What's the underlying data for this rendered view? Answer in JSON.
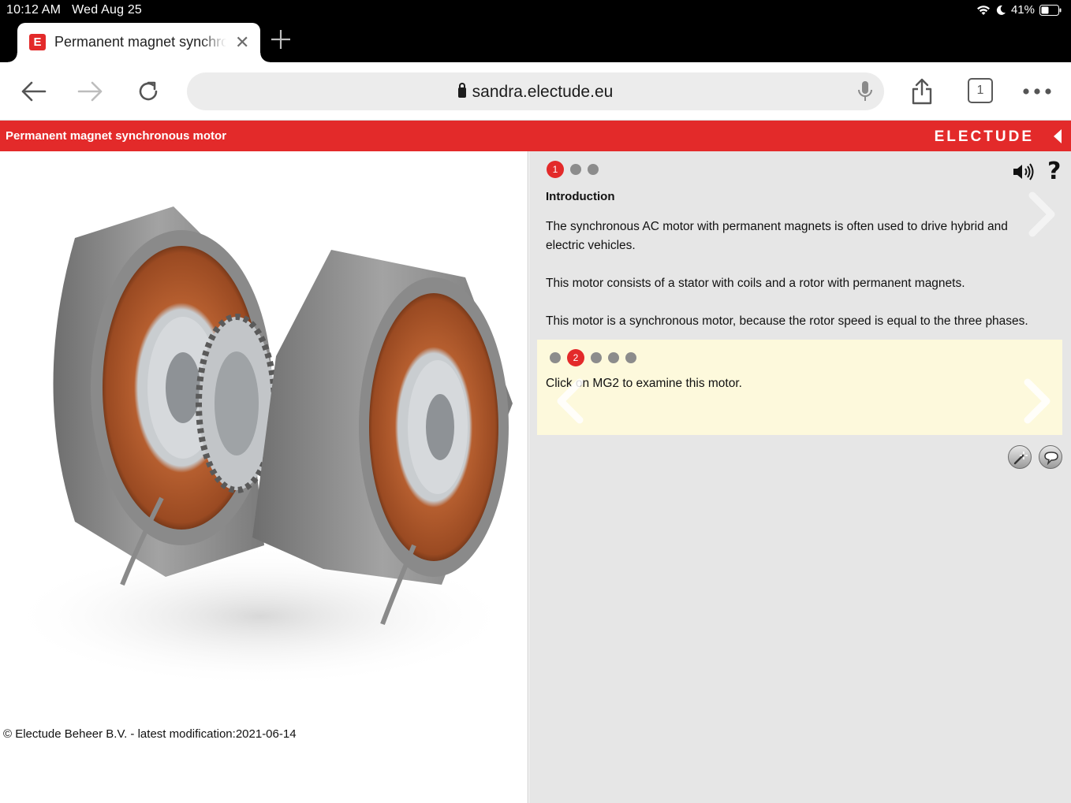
{
  "status_bar": {
    "time": "10:12 AM",
    "date": "Wed Aug 25",
    "battery": "41%"
  },
  "browser": {
    "tab_title": "Permanent magnet synchronous motor",
    "favicon_letter": "E",
    "address": "sandra.electude.eu",
    "tab_count": "1",
    "icons": [
      "back-icon",
      "forward-icon",
      "reload-icon",
      "lock-icon",
      "microphone-icon",
      "share-icon",
      "tabs-icon",
      "more-icon"
    ]
  },
  "header": {
    "title": "Permanent magnet synchronous motor",
    "brand": "ELECTUDE"
  },
  "left_pane": {
    "image_alt": "Permanent magnet synchronous motor stator and rotor",
    "copyright": "© Electude Beheer B.V. - latest modification:2021-06-14"
  },
  "right_pane": {
    "intro_step_active": "1",
    "intro_title": "Introduction",
    "paragraphs": [
      "The synchronous AC motor with permanent magnets is often used to drive hybrid and electric vehicles.",
      "This motor consists of a stator with coils and a rotor with permanent magnets.",
      "This motor is a synchronous motor, because the rotor speed is equal to the three phases."
    ],
    "help_label": "?",
    "task_step_active": "2",
    "task_text": "Click on MG2 to examine this motor.",
    "colors": {
      "accent": "#e32a2a",
      "task_bg": "#fdf9dc",
      "pane_bg": "#e6e6e6"
    }
  }
}
